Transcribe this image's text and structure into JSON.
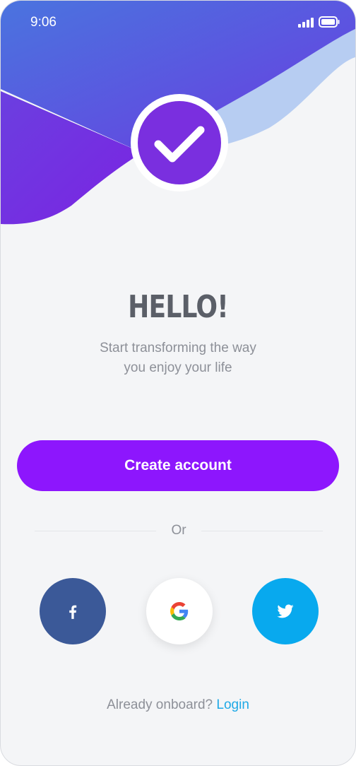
{
  "status_bar": {
    "time": "9:06",
    "signal_icon": "cellular-signal-icon",
    "battery_icon": "battery-icon"
  },
  "colors": {
    "gradient_start": "#4d6fe0",
    "gradient_end": "#7b28e0",
    "accent_light": "#b7cdf2",
    "primary": "#8d16fd",
    "facebook": "#3b5998",
    "twitter": "#08a9ee",
    "link": "#1fa9e6"
  },
  "hero": {
    "badge_icon": "checkmark-icon"
  },
  "welcome": {
    "title": "HELLO!",
    "subtitle_line1": "Start transforming the way",
    "subtitle_line2": "you enjoy your life"
  },
  "actions": {
    "create_account_label": "Create account",
    "divider_text": "Or"
  },
  "social": [
    {
      "name": "facebook",
      "icon": "facebook-icon"
    },
    {
      "name": "google",
      "icon": "google-icon"
    },
    {
      "name": "twitter",
      "icon": "twitter-icon"
    }
  ],
  "footer": {
    "prompt": "Already onboard?",
    "login_label": "Login"
  }
}
